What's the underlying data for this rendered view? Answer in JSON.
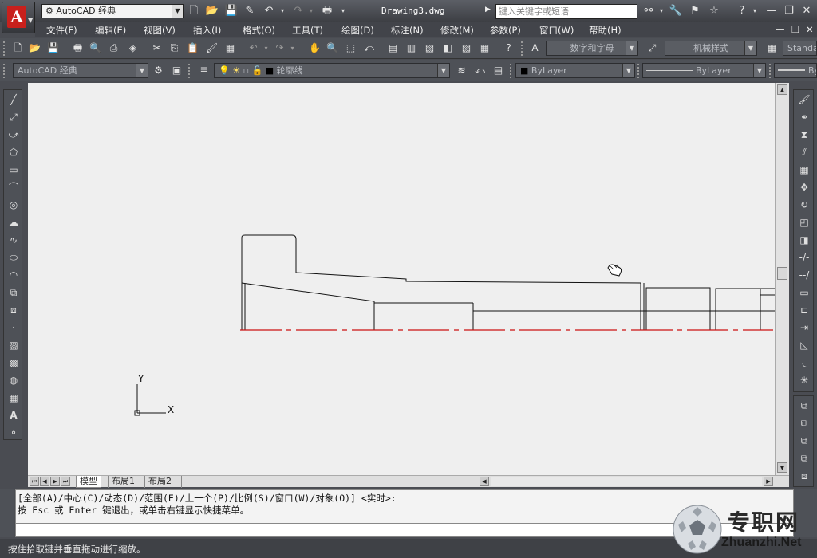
{
  "app": {
    "logo_letter": "A",
    "workspace": "AutoCAD 经典",
    "doc_title": "Drawing3.dwg",
    "search_placeholder": "键入关键字或短语"
  },
  "menus": [
    "文件(F)",
    "编辑(E)",
    "视图(V)",
    "插入(I)",
    "格式(O)",
    "工具(T)",
    "绘图(D)",
    "标注(N)",
    "修改(M)",
    "参数(P)",
    "窗口(W)",
    "帮助(H)"
  ],
  "toolbar2": {
    "text_style": "数字和字母",
    "dim_style": "机械样式",
    "table_style": "Standa"
  },
  "toolbar3": {
    "workspace": "AutoCAD 经典",
    "layer": "轮廓线",
    "color": "ByLayer",
    "linetype": "ByLayer",
    "lineweight": "By"
  },
  "canvas": {
    "ucs_x": "X",
    "ucs_y": "Y"
  },
  "layout_tabs": [
    "模型",
    "布局1",
    "布局2"
  ],
  "command": {
    "line1": "[全部(A)/中心(C)/动态(D)/范围(E)/上一个(P)/比例(S)/窗口(W)/对象(O)] <实时>:",
    "line2": "按 Esc 或 Enter 键退出，或单击右键显示快捷菜单。"
  },
  "status": {
    "text": "按住拾取键并垂直拖动进行缩放。"
  },
  "watermark": {
    "brand": "专职网",
    "url": "Zhuanzhi.Net"
  },
  "colors": {
    "centerline": "#cc1111",
    "accent": "#c8201c"
  }
}
